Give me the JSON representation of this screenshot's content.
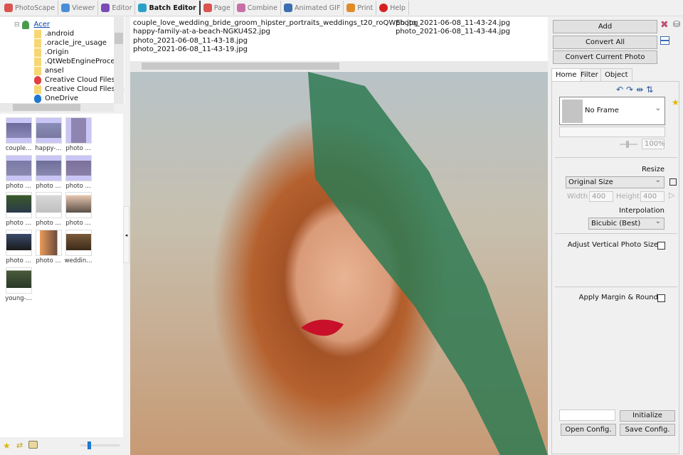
{
  "tabs": [
    {
      "label": "PhotoScape",
      "color": "#d9534f"
    },
    {
      "label": "Viewer",
      "color": "#4a8fd6"
    },
    {
      "label": "Editor",
      "color": "#7b4ab8"
    },
    {
      "label": "Batch Editor",
      "color": "#2aa0c8"
    },
    {
      "label": "Page",
      "color": "#d9534f"
    },
    {
      "label": "Combine",
      "color": "#c86fa8"
    },
    {
      "label": "Animated GIF",
      "color": "#3b6fb0"
    },
    {
      "label": "Print",
      "color": "#e08a2a"
    },
    {
      "label": "Help",
      "color": "#d62020"
    }
  ],
  "tree": {
    "root": "Acer",
    "items": [
      ".android",
      ".oracle_jre_usage",
      ".Origin",
      ".QtWebEngineProcess",
      "ansel",
      "Creative Cloud Files",
      "Creative Cloud Files (a",
      "OneDrive"
    ]
  },
  "thumbs": [
    "couple...",
    "happy-...",
    "photo ...",
    "photo ...",
    "photo ...",
    "photo ...",
    "photo ...",
    "photo ...",
    "photo ...",
    "photo ...",
    "photo ...",
    "weddin...",
    "young-..."
  ],
  "files": [
    "couple_love_wedding_bride_groom_hipster_portraits_weddings_t20_roQWEb.jpg",
    "happy-family-at-a-beach-NGKU4S2.jpg",
    "photo_2021-06-08_11-43-18.jpg",
    "photo_2021-06-08_11-43-19.jpg",
    "photo_2021-06-08_11-43-24.jpg",
    "photo_2021-06-08_11-43-44.jpg"
  ],
  "right": {
    "add": "Add",
    "convert_all": "Convert All",
    "convert_current": "Convert Current Photo",
    "tabs": [
      "Home",
      "Filter",
      "Object"
    ],
    "frame": "No Frame",
    "frame_zoom": "100%",
    "resize_label": "Resize",
    "resize_value": "Original Size",
    "width_label": "Width",
    "width_value": "400",
    "height_label": "Height",
    "height_value": "400",
    "interp_label": "Interpolation",
    "interp_value": "Bicubic (Best)",
    "adjust_vertical": "Adjust Vertical Photo Size",
    "apply_margin": "Apply Margin & Round",
    "initialize": "Initialize",
    "open_config": "Open Config.",
    "save_config": "Save Config."
  }
}
